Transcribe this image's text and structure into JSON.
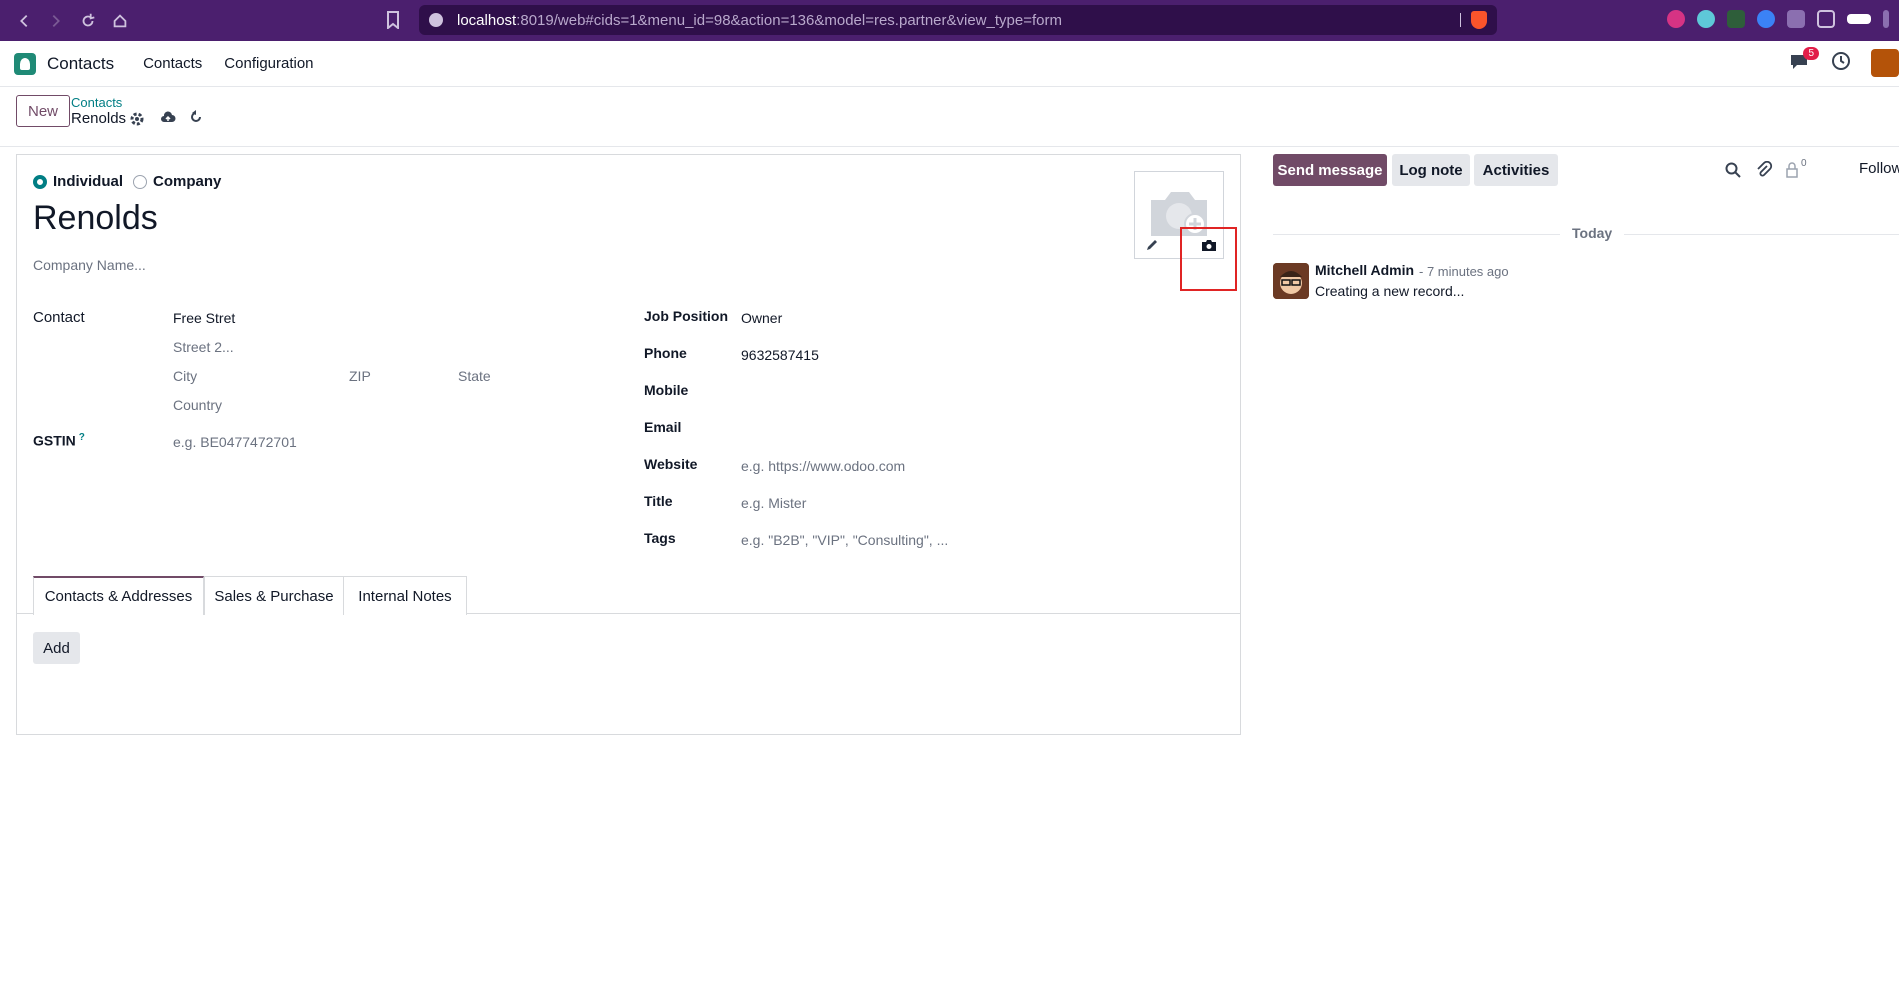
{
  "browser": {
    "url_host": "localhost",
    "url_rest": ":8019/web#cids=1&menu_id=98&action=136&model=res.partner&view_type=form"
  },
  "navbar": {
    "app_name": "Contacts",
    "menu_items": [
      "Contacts",
      "Configuration"
    ],
    "messages_badge": "5"
  },
  "control_panel": {
    "new_label": "New",
    "breadcrumb_parent": "Contacts",
    "breadcrumb_current": "Renolds"
  },
  "form": {
    "type_options": [
      "Individual",
      "Company"
    ],
    "selected_type": "Individual",
    "name": "Renolds",
    "company_placeholder": "Company Name...",
    "address": {
      "label": "Contact",
      "street": "Free Stret",
      "street2_placeholder": "Street 2...",
      "city_placeholder": "City",
      "zip_placeholder": "ZIP",
      "state_placeholder": "State",
      "country_placeholder": "Country"
    },
    "gstin": {
      "label": "GSTIN",
      "help": "?",
      "placeholder": "e.g. BE0477472701"
    },
    "right_fields": {
      "job_position_label": "Job Position",
      "job_position_value": "Owner",
      "phone_label": "Phone",
      "phone_value": "9632587415",
      "mobile_label": "Mobile",
      "email_label": "Email",
      "website_label": "Website",
      "website_placeholder": "e.g. https://www.odoo.com",
      "title_label": "Title",
      "title_placeholder": "e.g. Mister",
      "tags_label": "Tags",
      "tags_placeholder": "e.g. \"B2B\", \"VIP\", \"Consulting\", ..."
    },
    "tabs": [
      "Contacts & Addresses",
      "Sales & Purchase",
      "Internal Notes"
    ],
    "active_tab": "Contacts & Addresses",
    "add_label": "Add"
  },
  "chatter": {
    "send_message": "Send message",
    "log_note": "Log note",
    "activities": "Activities",
    "followers_count": "0",
    "follow_label": "Follow",
    "date_separator": "Today",
    "message": {
      "author": "Mitchell Admin",
      "time": "- 7 minutes ago",
      "body": "Creating a new record..."
    }
  },
  "colors": {
    "primary": "#714b67",
    "accent": "#017e84",
    "browser_bar": "#4b1f6e",
    "highlight": "#e02424"
  }
}
